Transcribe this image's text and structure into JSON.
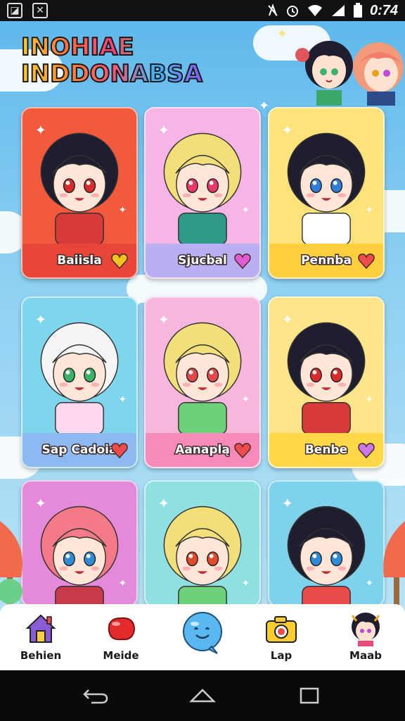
{
  "status_bar": {
    "time": "0:74",
    "left_icons": [
      "image-icon",
      "close-box-icon"
    ],
    "right_icons": [
      "no-signal-icon",
      "alarm-icon",
      "wifi-icon",
      "signal-icon",
      "battery-icon"
    ]
  },
  "header": {
    "logo_line1": "INOHIAE",
    "logo_line2": "INDDONABSA"
  },
  "cards": [
    {
      "name": "Baiisla",
      "heart_color": "#f5c321",
      "bg": "#f25a3b",
      "footer": "#e9463a"
    },
    {
      "name": "Sjucbal",
      "heart_color": "#e25bd4",
      "bg": "#f7b5e6",
      "footer": "#b8b0f2"
    },
    {
      "name": "Pennba",
      "heart_color": "#ee4b4b",
      "bg": "#ffe27a",
      "footer": "#ffcf3f"
    },
    {
      "name": "Sap Cadoia",
      "heart_color": "#ee4b4b",
      "bg": "#7ed6ec",
      "footer": "#8db9f0"
    },
    {
      "name": "Aanaplą",
      "heart_color": "#ee4b4b",
      "bg": "#f9b6dd",
      "footer": "#f68ab9"
    },
    {
      "name": "Benbe",
      "heart_color": "#c978e8",
      "bg": "#ffe58a",
      "footer": "#ffd84a"
    },
    {
      "name": "",
      "heart_color": "",
      "bg": "#e58ad8",
      "footer": ""
    },
    {
      "name": "",
      "heart_color": "",
      "bg": "#8fe0e0",
      "footer": ""
    },
    {
      "name": "",
      "heart_color": "",
      "bg": "#7fd2ec",
      "footer": ""
    }
  ],
  "bottom_nav": [
    {
      "label": "Behien",
      "icon": "home-icon"
    },
    {
      "label": "Meide",
      "icon": "red-blob-icon"
    },
    {
      "label": "",
      "icon": "chat-bubble-icon"
    },
    {
      "label": "Lap",
      "icon": "camera-icon"
    },
    {
      "label": "Maab",
      "icon": "avatar-icon"
    }
  ],
  "system_nav": [
    "back-icon",
    "home-outline-icon",
    "recents-icon"
  ]
}
